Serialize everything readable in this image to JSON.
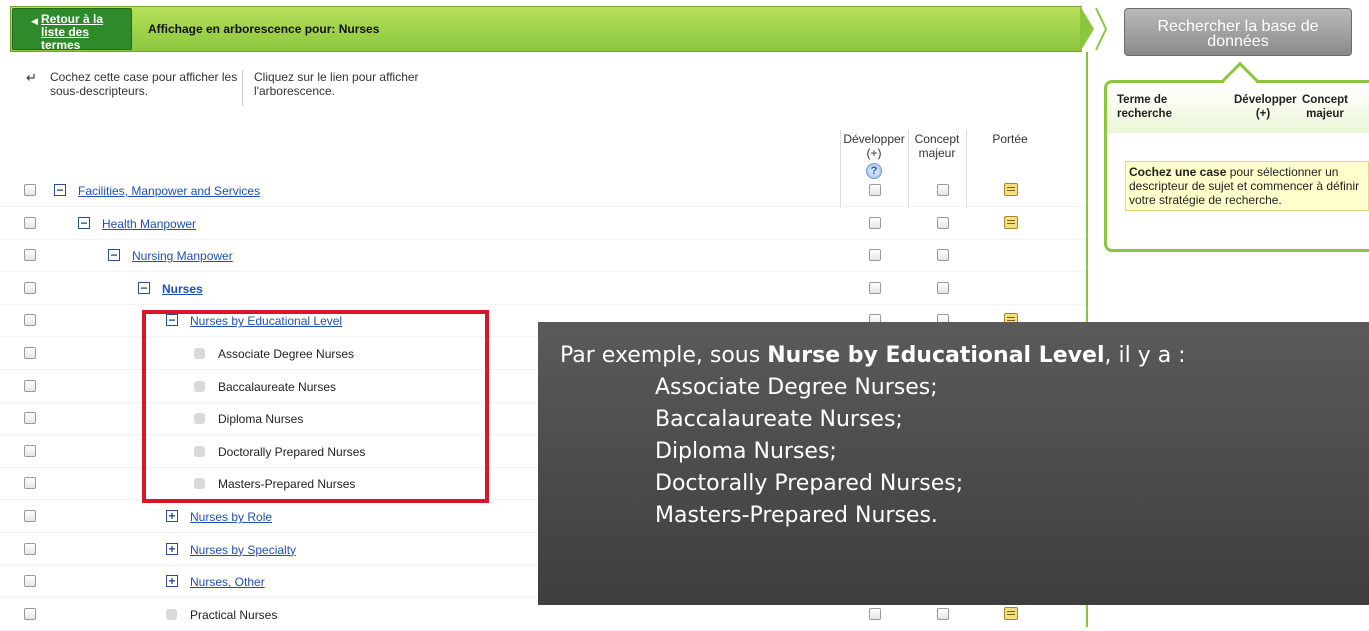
{
  "header": {
    "back_label": "Retour à la liste des termes",
    "title": "Affichage en arborescence pour: Nurses",
    "bar_color": "#8cc63f"
  },
  "instructions": {
    "checkbox_hint": "Cochez cette case pour afficher les sous-descripteurs.",
    "link_hint": "Cliquez sur le lien pour afficher l'arborescence."
  },
  "columns": {
    "develop": "Développer (+)",
    "develop_help": "?",
    "major": "Concept majeur",
    "scope": "Portée"
  },
  "tree": [
    {
      "label": "Facilities, Manpower and Services",
      "toggle": "minus",
      "level": 0,
      "link": true,
      "scope": true
    },
    {
      "label": "Health Manpower",
      "toggle": "minus",
      "level": 1,
      "link": true,
      "scope": true
    },
    {
      "label": "Nursing Manpower",
      "toggle": "minus",
      "level": 2,
      "link": true,
      "scope": false
    },
    {
      "label": "Nurses",
      "toggle": "minus",
      "level": 3,
      "link": true,
      "bold": true,
      "scope": false
    },
    {
      "label": "Nurses by Educational Level",
      "toggle": "minus",
      "level": 4,
      "link": true,
      "scope": true
    },
    {
      "label": "Associate Degree Nurses",
      "toggle": "leaf",
      "level": 5,
      "link": false,
      "scope": false
    },
    {
      "label": "Baccalaureate Nurses",
      "toggle": "leaf",
      "level": 5,
      "link": false,
      "scope": false
    },
    {
      "label": "Diploma Nurses",
      "toggle": "leaf",
      "level": 5,
      "link": false,
      "scope": false
    },
    {
      "label": "Doctorally Prepared Nurses",
      "toggle": "leaf",
      "level": 5,
      "link": false,
      "scope": false
    },
    {
      "label": "Masters-Prepared Nurses",
      "toggle": "leaf",
      "level": 5,
      "link": false,
      "scope": false
    },
    {
      "label": "Nurses by Role",
      "toggle": "plus",
      "level": 4,
      "link": true,
      "scope": false
    },
    {
      "label": "Nurses by Specialty",
      "toggle": "plus",
      "level": 4,
      "link": true,
      "scope": false
    },
    {
      "label": "Nurses, Other",
      "toggle": "plus",
      "level": 4,
      "link": true,
      "scope": false
    },
    {
      "label": "Practical Nurses",
      "toggle": "leaf",
      "level": 4,
      "link": false,
      "scope": true
    }
  ],
  "search_panel": {
    "search_button": "Rechercher la base de données",
    "col_term": "Terme de recherche",
    "col_develop": "Développer (+)",
    "col_major": "Concept majeur",
    "hint_bold": "Cochez une case",
    "hint_rest": " pour sélectionner un descripteur de sujet et commencer à définir votre stratégie de recherche."
  },
  "callout": {
    "lead_prefix": "Par exemple, sous ",
    "lead_bold": "Nurse by Educational Level",
    "lead_suffix": ", il y a :",
    "items": [
      "Associate Degree Nurses;",
      "Baccalaureate Nurses;",
      "Diploma Nurses;",
      "Doctorally Prepared Nurses;",
      "Masters-Prepared Nurses."
    ]
  }
}
